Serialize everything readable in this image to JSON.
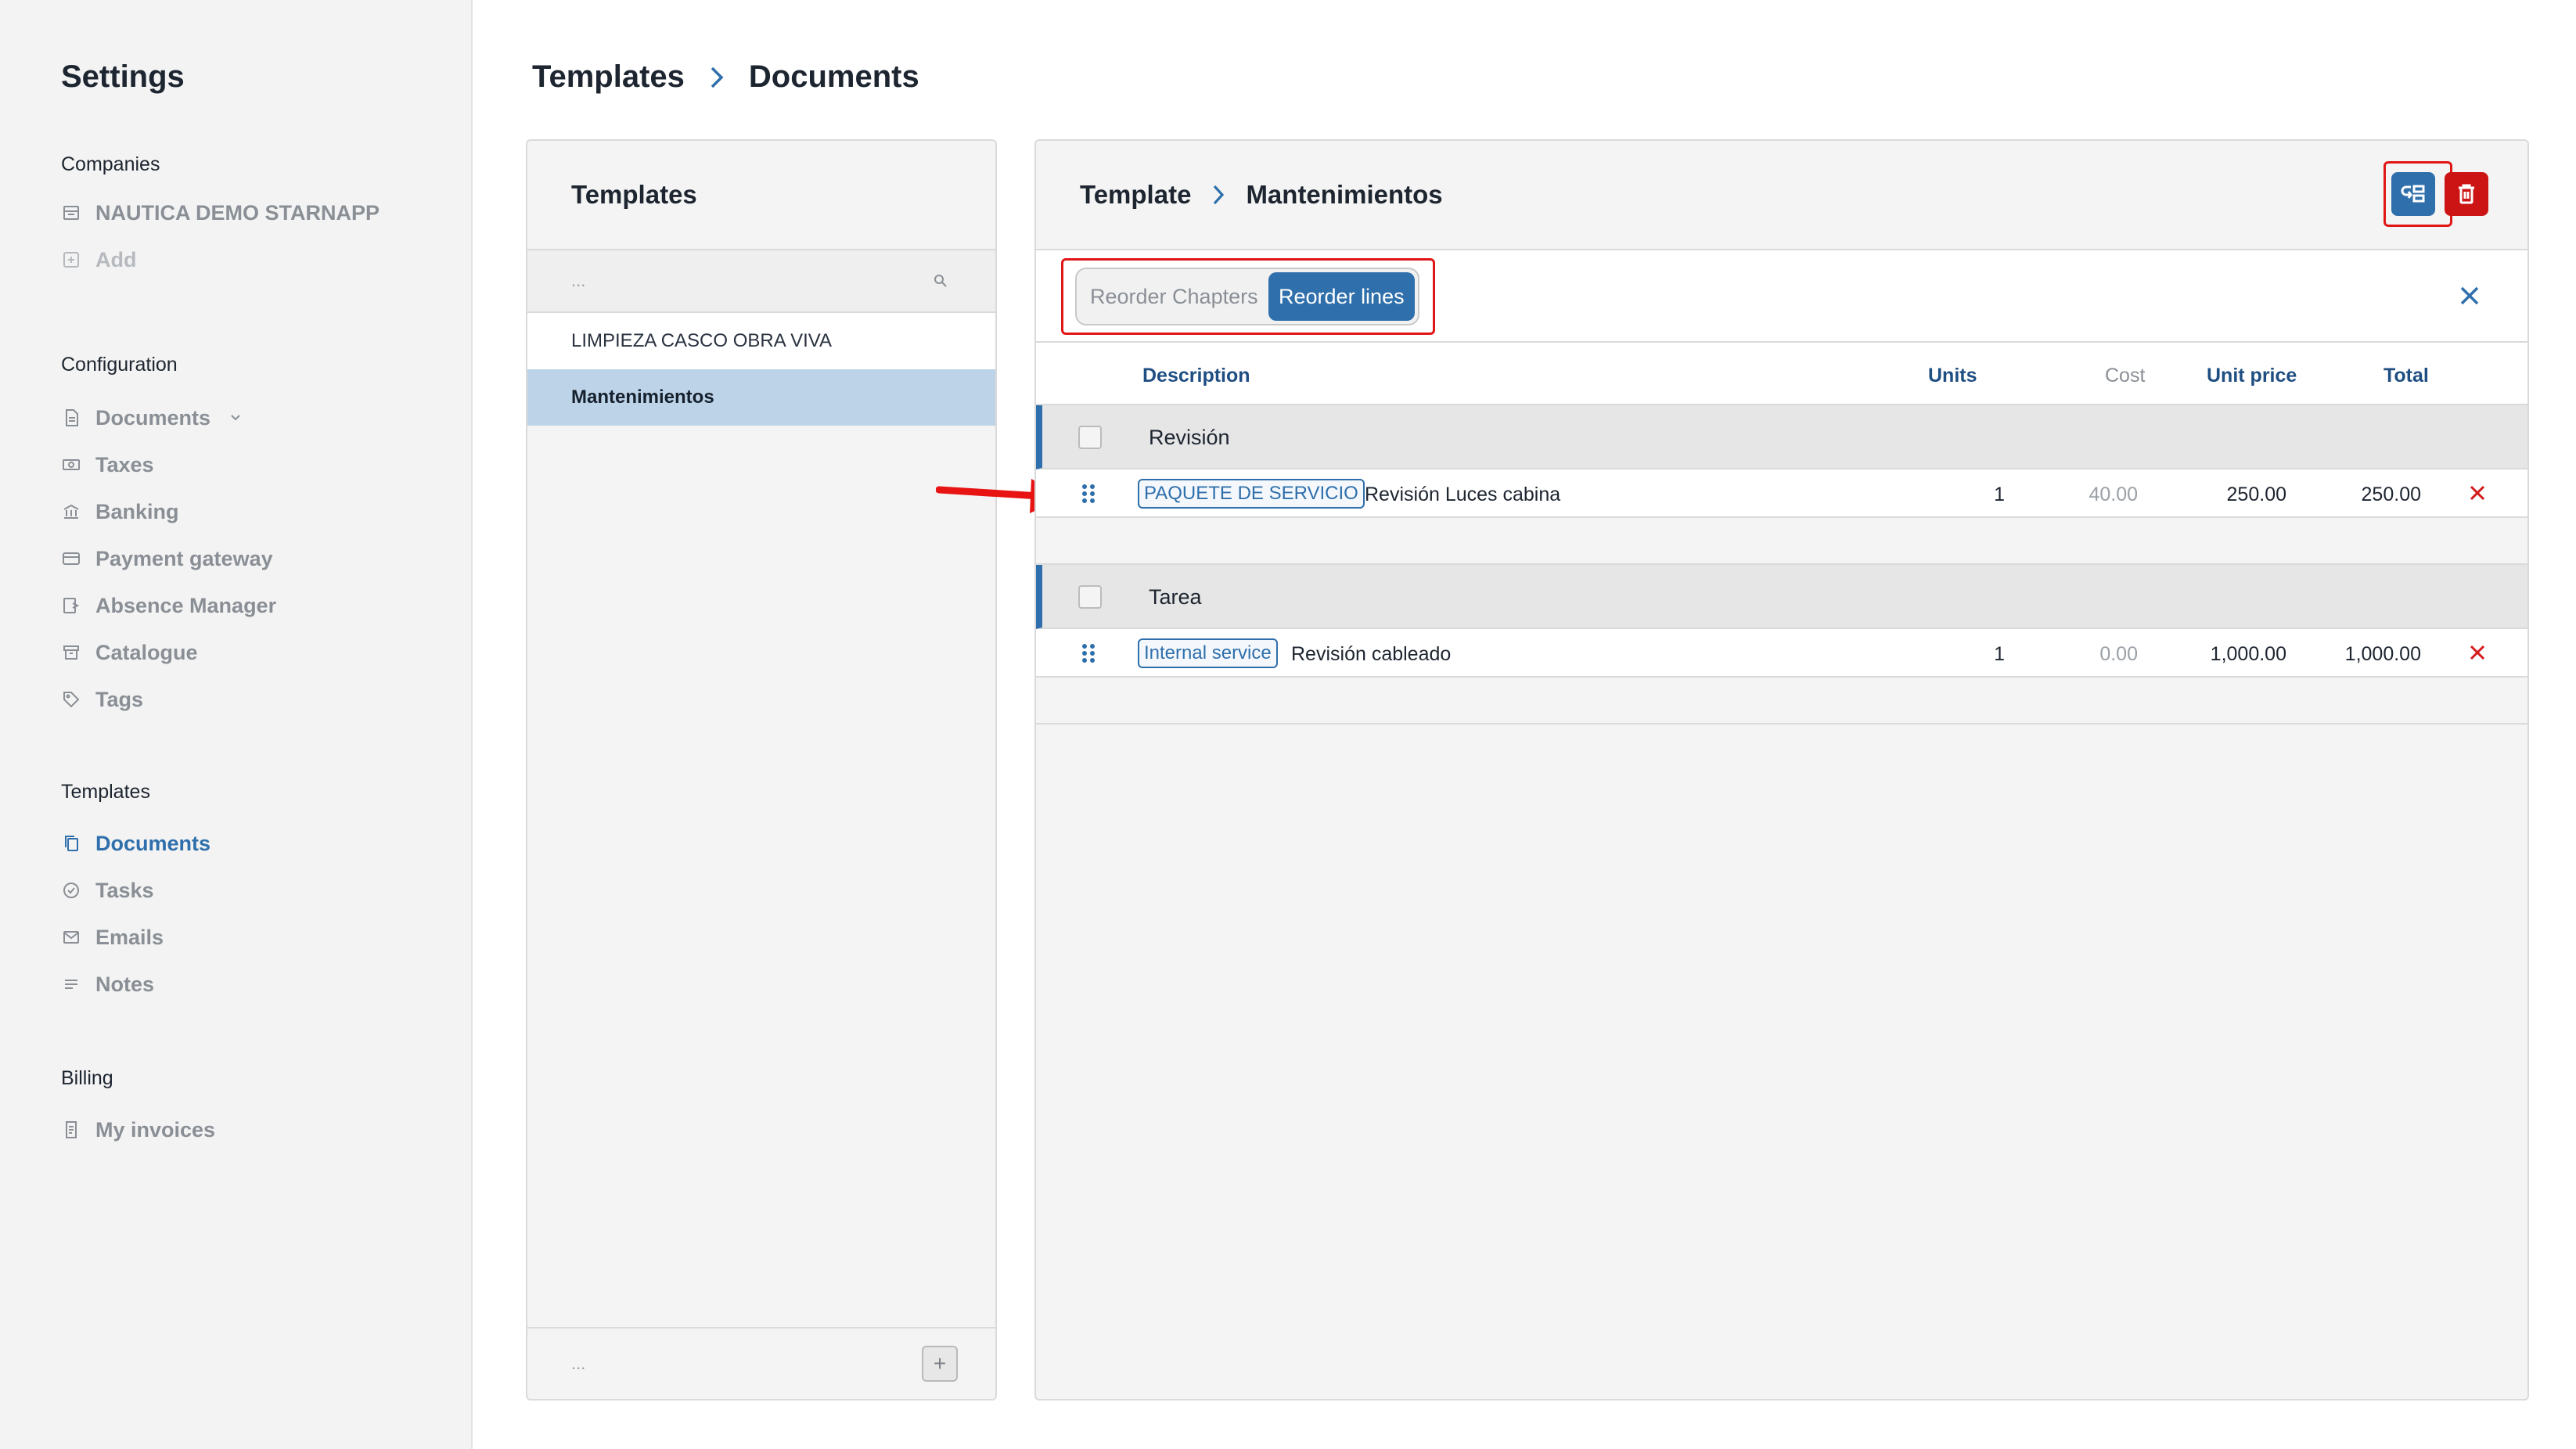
{
  "sidebar": {
    "title": "Settings",
    "sections": {
      "companies": "Companies",
      "configuration": "Configuration",
      "templates": "Templates",
      "billing": "Billing"
    },
    "companies": [
      {
        "label": "NAUTICA DEMO STARNAPP",
        "icon": "building-icon"
      },
      {
        "label": "Add",
        "icon": "plus-square-icon"
      }
    ],
    "configuration": [
      {
        "label": "Documents",
        "icon": "document-icon"
      },
      {
        "label": "Taxes",
        "icon": "banknote-icon"
      },
      {
        "label": "Banking",
        "icon": "bank-icon"
      },
      {
        "label": "Payment gateway",
        "icon": "card-icon"
      },
      {
        "label": "Absence Manager",
        "icon": "exit-icon"
      },
      {
        "label": "Catalogue",
        "icon": "archive-icon"
      },
      {
        "label": "Tags",
        "icon": "tag-icon"
      }
    ],
    "templates": [
      {
        "label": "Documents",
        "icon": "copy-icon",
        "active": true
      },
      {
        "label": "Tasks",
        "icon": "check-circle-icon"
      },
      {
        "label": "Emails",
        "icon": "mail-icon"
      },
      {
        "label": "Notes",
        "icon": "lines-icon"
      }
    ],
    "billing": [
      {
        "label": "My invoices",
        "icon": "invoice-icon"
      }
    ]
  },
  "breadcrumb": {
    "first": "Templates",
    "second": "Documents"
  },
  "templates_panel": {
    "title": "Templates",
    "search_placeholder": "...",
    "items": [
      {
        "label": "LIMPIEZA CASCO OBRA VIVA",
        "selected": false
      },
      {
        "label": "Mantenimientos",
        "selected": true
      }
    ],
    "footer_placeholder": "...",
    "add_label": "+"
  },
  "detail": {
    "crumb_first": "Template",
    "crumb_second": "Mantenimientos",
    "toggle": {
      "chapters": "Reorder Chapters",
      "lines": "Reorder lines",
      "active": "lines"
    },
    "columns": {
      "description": "Description",
      "units": "Units",
      "cost": "Cost",
      "unit_price": "Unit price",
      "total": "Total"
    },
    "chapters": [
      {
        "name": "Revisión",
        "lines": [
          {
            "tag": "PAQUETE DE SERVICIO",
            "description": "Revisión Luces cabina",
            "units": "1",
            "cost": "40.00",
            "unit_price": "250.00",
            "total": "250.00"
          }
        ]
      },
      {
        "name": "Tarea",
        "lines": [
          {
            "tag": "Internal service",
            "description": "Revisión cableado",
            "units": "1",
            "cost": "0.00",
            "unit_price": "1,000.00",
            "total": "1,000.00"
          }
        ]
      }
    ]
  },
  "colors": {
    "accent": "#2f6fab",
    "danger": "#cc1414",
    "highlight": "#e01616",
    "selected_bg": "#bdd3e8"
  }
}
